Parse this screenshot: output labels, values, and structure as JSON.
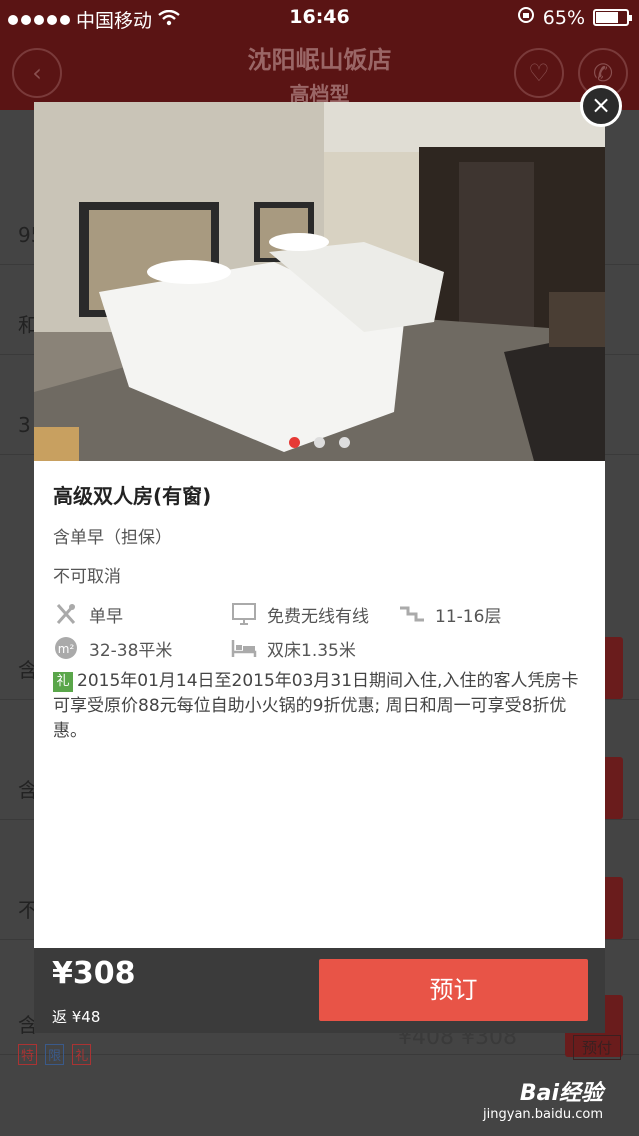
{
  "status_bar": {
    "carrier": "中国移动",
    "time": "16:46",
    "battery": "65%"
  },
  "header": {
    "title": "沈阳岷山饭店",
    "subtitle": "高档型"
  },
  "background": {
    "rows": [
      {
        "text": "95"
      },
      {
        "text": "和"
      },
      {
        "text": "3"
      },
      {
        "text": "含"
      },
      {
        "text": "含"
      },
      {
        "text": "不"
      },
      {
        "text": "含"
      }
    ],
    "tags": [
      "特",
      "限",
      "礼"
    ],
    "bottom_price": "¥408 ¥308",
    "prepay": "预付"
  },
  "modal": {
    "close": "×",
    "carousel": {
      "total": 3,
      "active": 0
    },
    "room_name": "高级双人房(有窗)",
    "breakfast_note": "含单早（担保）",
    "cancel_policy": "不可取消",
    "facilities": [
      {
        "icon": "utensils-icon",
        "label": "单早"
      },
      {
        "icon": "computer-icon",
        "label": "免费无线有线"
      },
      {
        "icon": "stairs-icon",
        "label": "11-16层"
      },
      {
        "icon": "area-icon",
        "label": "32-38平米"
      },
      {
        "icon": "bed-icon",
        "label": "双床1.35米"
      }
    ],
    "promo_tag": "礼",
    "promo_text": "2015年01月14日至2015年03月31日期间入住,入住的客人凭房卡可享受原价88元每位自助小火锅的9折优惠; 周日和周一可享受8折优惠。"
  },
  "footer": {
    "price": "¥308",
    "cashback": "返 ¥48",
    "book_label": "预订"
  },
  "watermark": {
    "brand": "Bai经验",
    "url": "jingyan.baidu.com"
  }
}
